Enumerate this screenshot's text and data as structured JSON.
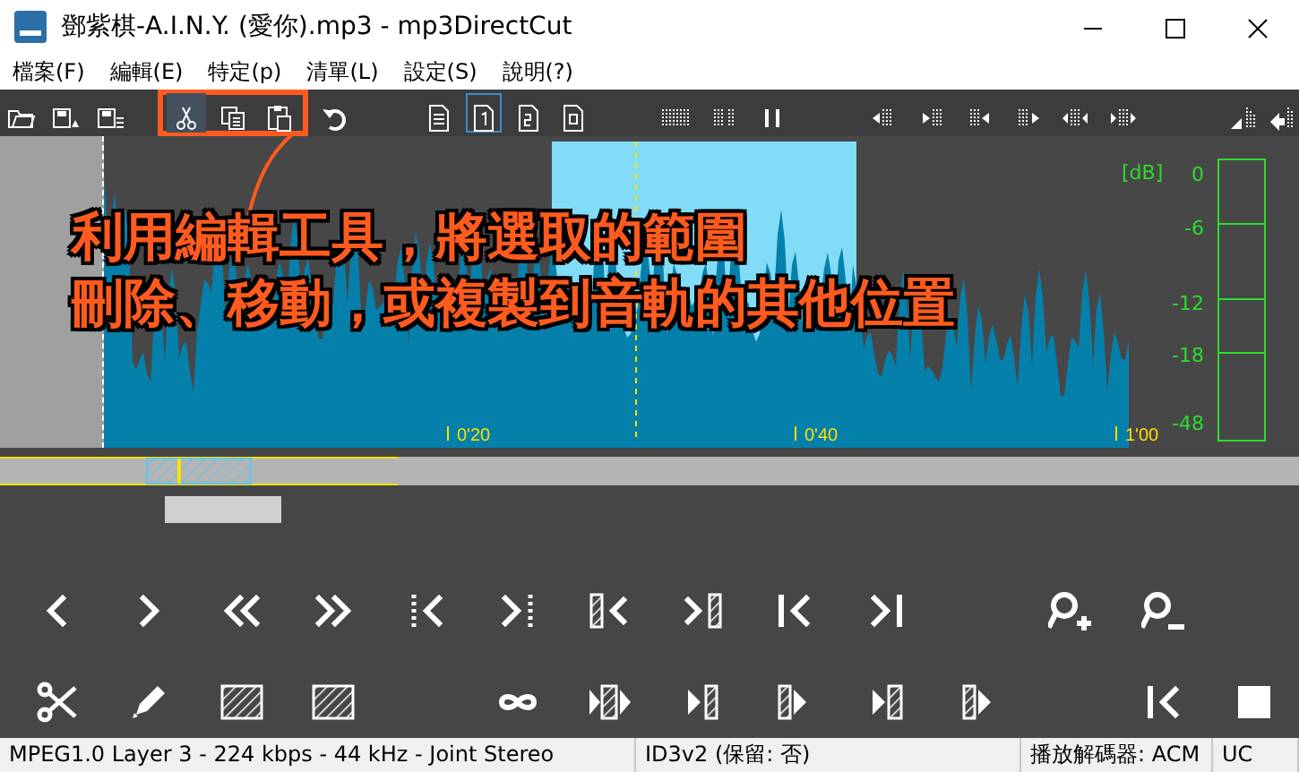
{
  "window": {
    "title": "鄧紫棋-A.I.N.Y. (愛你).mp3 - mp3DirectCut"
  },
  "menu": [
    "檔案(F)",
    "編輯(E)",
    "特定(p)",
    "清單(L)",
    "設定(S)",
    "說明(?)"
  ],
  "toolbar": [
    {
      "kind": "open",
      "selected": false
    },
    {
      "kind": "save-wave",
      "selected": false
    },
    {
      "kind": "save-list",
      "selected": false
    },
    {
      "kind": "cut",
      "selected": true
    },
    {
      "kind": "copy",
      "selected": false
    },
    {
      "kind": "paste",
      "selected": false
    },
    {
      "kind": "undo",
      "selected": false
    },
    {
      "kind": "page",
      "selected": false
    },
    {
      "kind": "page-one",
      "selected": true
    },
    {
      "kind": "page-two",
      "selected": false
    },
    {
      "kind": "page-zoom",
      "selected": false
    },
    {
      "kind": "bars",
      "selected": false
    },
    {
      "kind": "bar-pair",
      "selected": false
    },
    {
      "kind": "pause",
      "selected": false
    },
    {
      "kind": "arrow-left-bar",
      "selected": false
    },
    {
      "kind": "arrow-right-bar",
      "selected": false
    },
    {
      "kind": "bar-arrow-left",
      "selected": false
    },
    {
      "kind": "bar-arrow-right",
      "selected": false
    },
    {
      "kind": "arrows-left",
      "selected": false
    },
    {
      "kind": "arrows-right",
      "selected": false
    },
    {
      "kind": "level-a",
      "selected": false
    },
    {
      "kind": "level-b",
      "selected": false
    }
  ],
  "callout": {
    "lines": [
      "利用編輯工具，將選取的範圍",
      "刪除、移動，或複製到音軌的其他位置"
    ]
  },
  "waveform": {
    "time_labels": [
      "0'20",
      "0'40",
      "1'00"
    ]
  },
  "meter": {
    "unit": "[dB]",
    "scale": [
      "0",
      "-6",
      "-12",
      "-18",
      "-48"
    ]
  },
  "controls": [
    [
      {
        "kind": "prev"
      },
      {
        "kind": "next"
      },
      {
        "kind": "prev-fast"
      },
      {
        "kind": "next-fast"
      },
      {
        "kind": "bar-prev"
      },
      {
        "kind": "next-bar"
      },
      {
        "kind": "hatch-prev"
      },
      {
        "kind": "next-hatch"
      },
      {
        "kind": "to-start"
      },
      {
        "kind": "to-end"
      },
      {
        "kind": "zoom-in"
      },
      {
        "kind": "zoom-out"
      }
    ],
    [
      {
        "kind": "scissors"
      },
      {
        "kind": "pencil"
      },
      {
        "kind": "hatch"
      },
      {
        "kind": "hatch-thin"
      },
      {
        "kind": "loop"
      },
      {
        "kind": "play-hatch-play"
      },
      {
        "kind": "play-hatch"
      },
      {
        "kind": "hatch-play"
      },
      {
        "kind": "play-hatch-end"
      },
      {
        "kind": "hatch-play-end"
      },
      {
        "kind": "to-start"
      },
      {
        "kind": "stop"
      }
    ]
  ],
  "status_bar": [
    "MPEG1.0 Layer 3 - 224 kbps - 44 kHz - Joint Stereo",
    "ID3v2 (保留: 否)",
    "播放解碼器: ACM",
    "UC"
  ]
}
